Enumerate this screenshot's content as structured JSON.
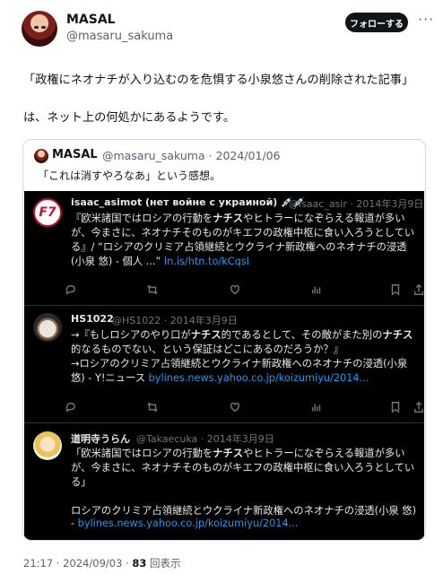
{
  "author": {
    "name": "MASAL",
    "handle": "@masaru_sakuma"
  },
  "follow_label": "フォローする",
  "more_label": "···",
  "tweet": {
    "line1": "「政権にネオナチが入り込むのを危惧する小泉悠さんの削除された記事」",
    "line2": "は、ネット上の何処かにあるようです。"
  },
  "quote": {
    "name": "MASAL",
    "meta": "@masaru_sakuma · 2024/01/06",
    "text": "「これは消すやろなあ」という感想。"
  },
  "cards": [
    {
      "name": "isaac_asimot (нет войне с украиной) 💉💉",
      "meta": "@isaac_asir · 2014年3月9日",
      "avatar_label": "F7",
      "lines": [
        "『欧米諸国ではロシアの行動をナチスやヒトラーになぞらえる報道が多い",
        "が、今まさに、ネオナチそのものがキエフの政権中枢に食い入ろうとしてい",
        "る』/ “ロシアのクリミア占領継続とウクライナ新政権へのネオナチの浸透",
        "(小泉 悠) - 個人 ...” "
      ],
      "link": "ln.is/htn.to/kCqsI"
    },
    {
      "name": "HS1022",
      "meta": "@HS1022 · 2014年3月9日",
      "lines": [
        "→『もしロシアのやり口がナチス的であるとして、その敵がまた別のナチス",
        "的なるものでない、という保証はどこにあるのだろうか？』",
        "→ロシアのクリミア占領継続とウクライナ新政権へのネオナチの浸透(小泉",
        "悠) - Y!ニュース "
      ],
      "link": "bylines.news.yahoo.co.jp/koizumiyu/2014..."
    },
    {
      "name": "道明寺うらん",
      "meta": "@Takaecuka · 2014年3月9日",
      "lines": [
        "「欧米諸国ではロシアの行動をナチスやヒトラーになぞらえる報道が多い",
        "が、今まさに、ネオナチそのものがキエフの政権中枢に食い入ろうとしてい",
        "る」",
        "",
        "ロシアのクリミア占領継続とウクライナ新政権へのネオナチの浸透(小泉 悠)",
        "- "
      ],
      "link": "bylines.news.yahoo.co.jp/koizumiyu/2014..."
    }
  ],
  "footer": {
    "time": "21:17 · 2024/09/03 · ",
    "views_count": "83",
    "views_label": " 回表示"
  },
  "icons": [
    "reply-icon",
    "retweet-icon",
    "like-icon",
    "views-icon",
    "bookmark-icon",
    "share-icon"
  ],
  "colors": {
    "link": "#1d9bf0",
    "dark_bg": "#000000",
    "follow_bg": "#0f1419"
  }
}
